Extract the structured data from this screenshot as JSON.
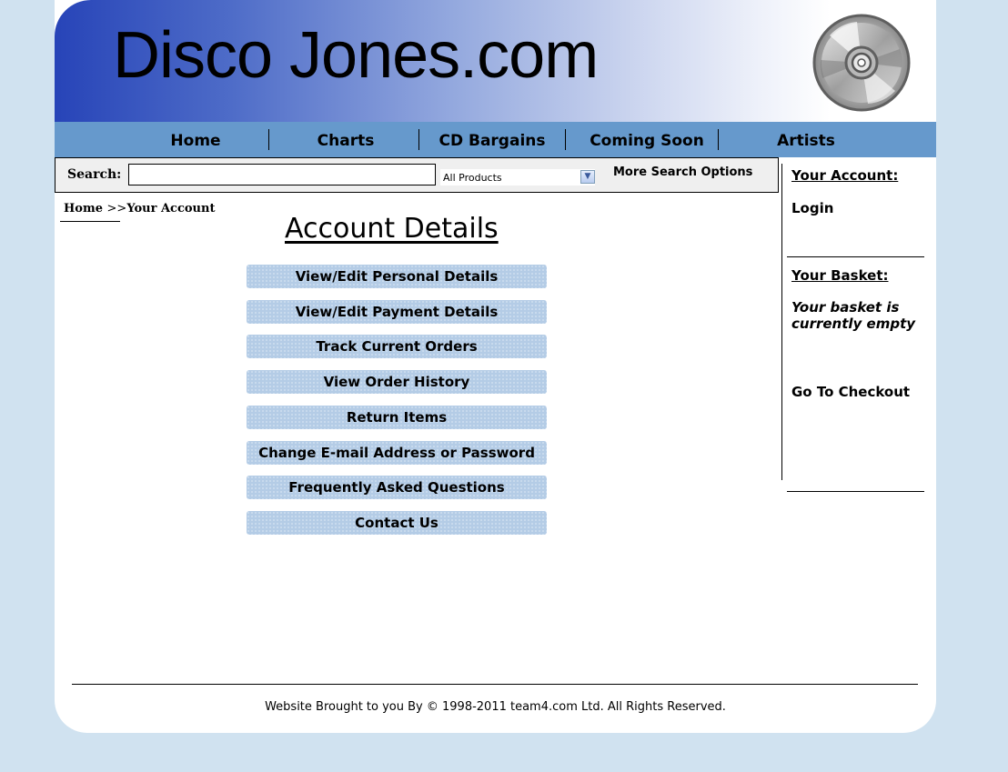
{
  "header": {
    "site_title": "Disco Jones.com",
    "logo_icon": "cd-disc-icon"
  },
  "nav": {
    "items": [
      {
        "label": "Home"
      },
      {
        "label": "Charts"
      },
      {
        "label": "CD Bargains"
      },
      {
        "label": "Coming Soon"
      },
      {
        "label": "Artists"
      }
    ]
  },
  "search": {
    "label": "Search:",
    "input_value": "",
    "category_selected": "All Products",
    "more_options": "More Search Options"
  },
  "breadcrumb": {
    "home": "Home",
    "separator": ">>",
    "current": "Your Account"
  },
  "main": {
    "heading": "Account Details",
    "menu": [
      {
        "label": "View/Edit Personal Details"
      },
      {
        "label": "View/Edit Payment Details"
      },
      {
        "label": "Track Current Orders"
      },
      {
        "label": "View Order History"
      },
      {
        "label": "Return Items"
      },
      {
        "label": "Change E-mail Address or Password"
      },
      {
        "label": "Frequently Asked Questions"
      },
      {
        "label": "Contact Us"
      }
    ]
  },
  "sidebar": {
    "account_heading": "Your Account:",
    "login": "Login",
    "basket_heading": "Your Basket:",
    "basket_message": "Your basket is currently empty",
    "checkout": "Go To Checkout"
  },
  "footer": {
    "text": "Website Brought to you By © 1998-2011 team4.com Ltd. All Rights Reserved."
  },
  "colors": {
    "background": "#d0e2f0",
    "nav_bar": "#6699cc",
    "banner_start": "#2744b8",
    "menu_button": "#b4cce6"
  }
}
